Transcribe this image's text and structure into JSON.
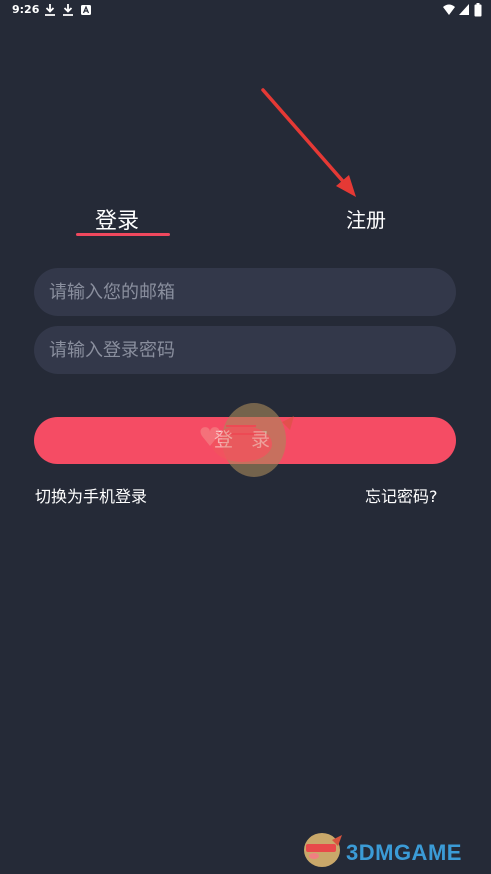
{
  "status_bar": {
    "time": "9:26",
    "left_icons": [
      "download-icon",
      "download-icon",
      "a-letter-icon"
    ],
    "right_icons": [
      "wifi-icon",
      "signal-icon",
      "battery-icon"
    ]
  },
  "tabs": {
    "login": "登录",
    "register": "注册",
    "active": "login"
  },
  "form": {
    "email_placeholder": "请输入您的邮箱",
    "email_value": "",
    "password_placeholder": "请输入登录密码",
    "password_value": ""
  },
  "login_button": "登 录",
  "links": {
    "switch_phone": "切换为手机登录",
    "forgot_password": "忘记密码?"
  },
  "watermark": {
    "text": "3DMGAME"
  },
  "colors": {
    "background": "#252a37",
    "input_bg": "#33384a",
    "accent": "#f54c64",
    "annotation_arrow": "#e53935"
  }
}
